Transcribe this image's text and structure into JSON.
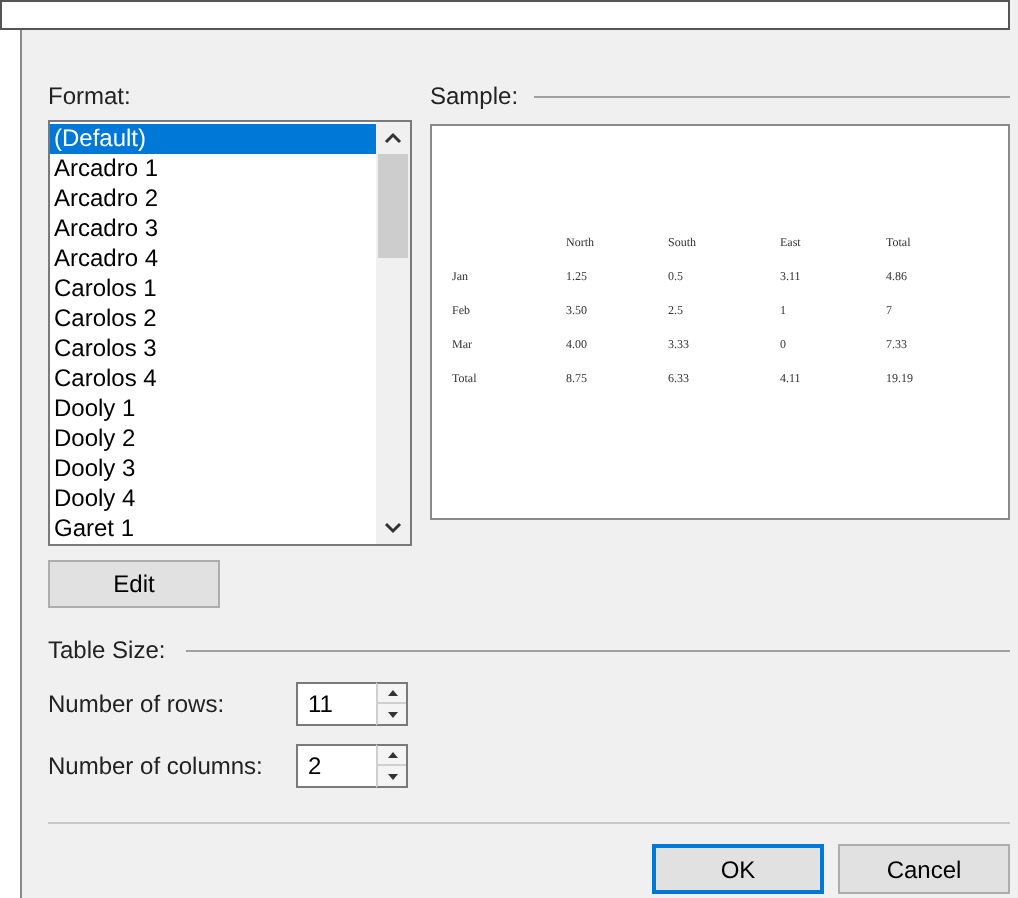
{
  "format": {
    "label": "Format:",
    "items": [
      {
        "label": "(Default)",
        "selected": true
      },
      {
        "label": "Arcadro 1",
        "selected": false
      },
      {
        "label": "Arcadro 2",
        "selected": false
      },
      {
        "label": "Arcadro 3",
        "selected": false
      },
      {
        "label": "Arcadro 4",
        "selected": false
      },
      {
        "label": "Carolos 1",
        "selected": false
      },
      {
        "label": "Carolos 2",
        "selected": false
      },
      {
        "label": "Carolos 3",
        "selected": false
      },
      {
        "label": "Carolos 4",
        "selected": false
      },
      {
        "label": "Dooly 1",
        "selected": false
      },
      {
        "label": "Dooly 2",
        "selected": false
      },
      {
        "label": "Dooly 3",
        "selected": false
      },
      {
        "label": "Dooly 4",
        "selected": false
      },
      {
        "label": "Garet 1",
        "selected": false
      }
    ],
    "edit_button": "Edit"
  },
  "sample": {
    "label": "Sample:",
    "rows": [
      [
        "",
        "North",
        "South",
        "East",
        "Total"
      ],
      [
        "Jan",
        "1.25",
        "0.5",
        "3.11",
        "4.86"
      ],
      [
        "Feb",
        "3.50",
        "2.5",
        "1",
        "7"
      ],
      [
        "Mar",
        "4.00",
        "3.33",
        "0",
        "7.33"
      ],
      [
        "Total",
        "8.75",
        "6.33",
        "4.11",
        "19.19"
      ]
    ]
  },
  "table_size": {
    "label": "Table Size:",
    "fields": [
      {
        "label": "Number of rows:",
        "value": "11"
      },
      {
        "label": "Number of columns:",
        "value": "2"
      }
    ]
  },
  "buttons": [
    {
      "label": "OK",
      "default": true
    },
    {
      "label": "Cancel",
      "default": false
    }
  ]
}
